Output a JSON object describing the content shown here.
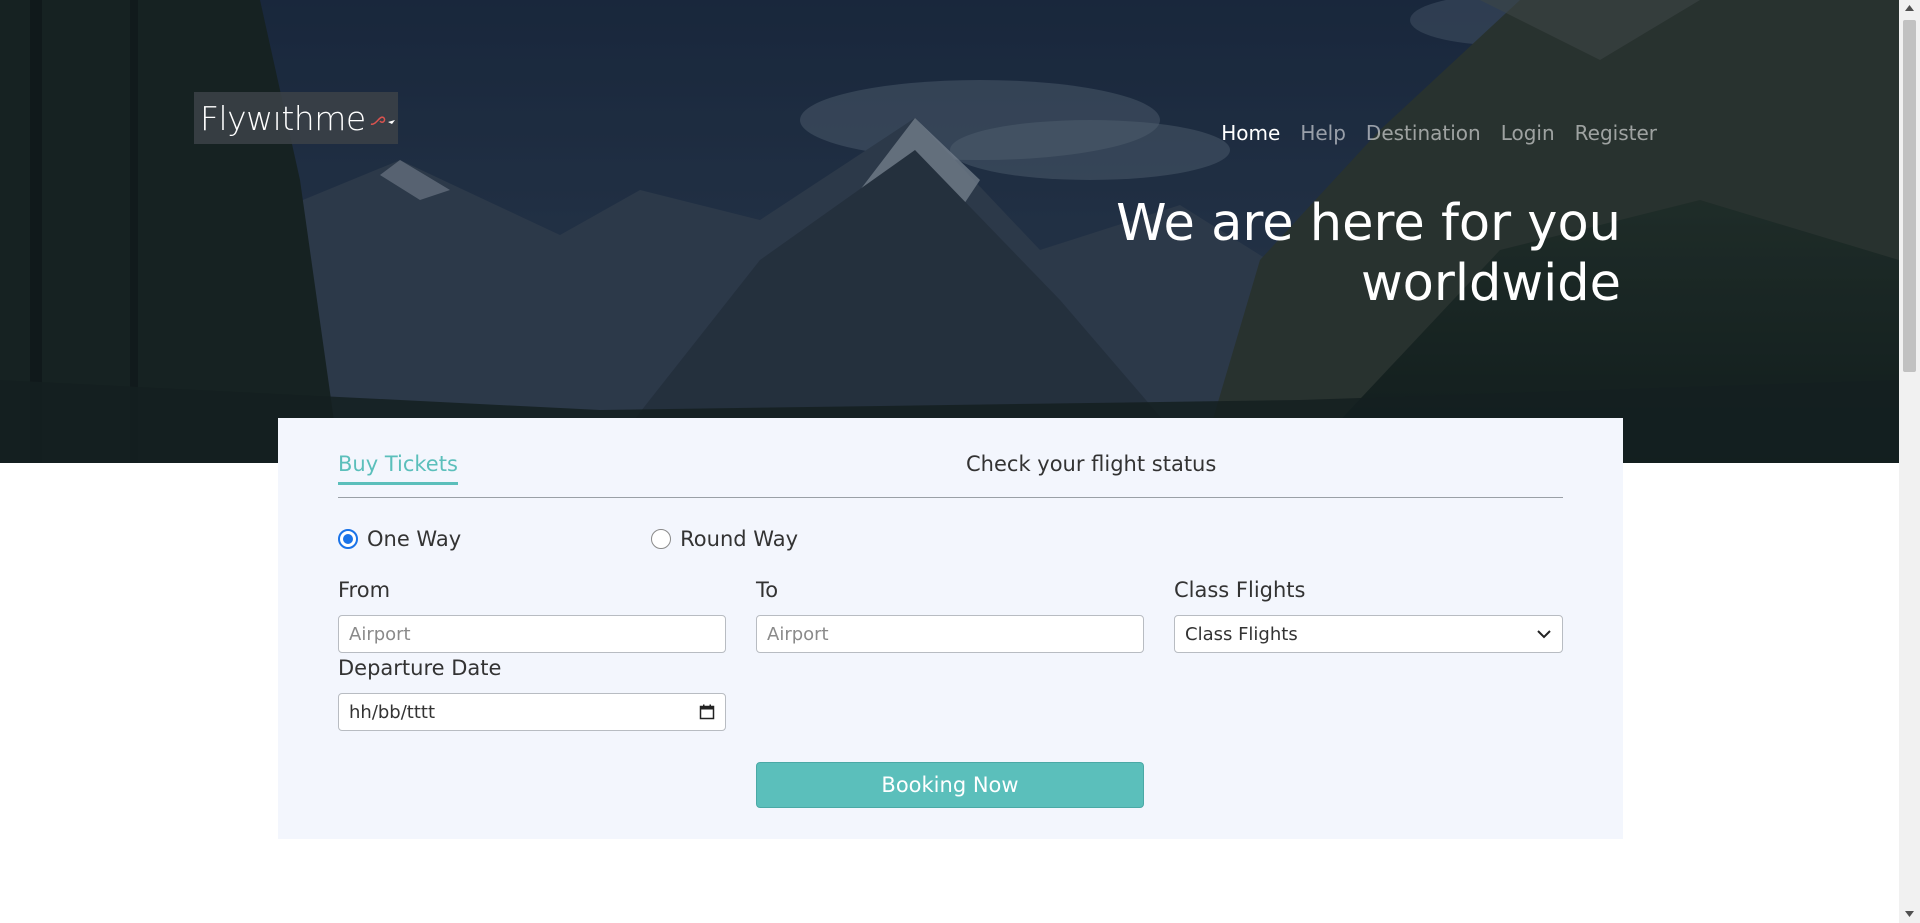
{
  "brand": {
    "logo_text": "Flywıthme"
  },
  "nav": {
    "items": [
      {
        "label": "Home",
        "active": true
      },
      {
        "label": "Help",
        "active": false
      },
      {
        "label": "Destination",
        "active": false
      },
      {
        "label": "Login",
        "active": false
      },
      {
        "label": "Register",
        "active": false
      }
    ]
  },
  "hero": {
    "heading_line1": "We are here for you",
    "heading_line2": "worldwide"
  },
  "booking": {
    "tabs": {
      "buy": "Buy Tickets",
      "status": "Check your flight status"
    },
    "trip_type": {
      "one_way": "One Way",
      "round_way": "Round Way",
      "selected": "One Way"
    },
    "from": {
      "label": "From",
      "placeholder": "Airport"
    },
    "to": {
      "label": "To",
      "placeholder": "Airport"
    },
    "class": {
      "label": "Class Flights",
      "selected": "Class Flights"
    },
    "departure": {
      "label": "Departure Date",
      "placeholder": "hh/bb/tttt"
    },
    "submit_label": "Booking Now"
  },
  "colors": {
    "accent": "#5bbfbb",
    "radio": "#1a73e8",
    "card_bg": "#f3f6fd"
  }
}
